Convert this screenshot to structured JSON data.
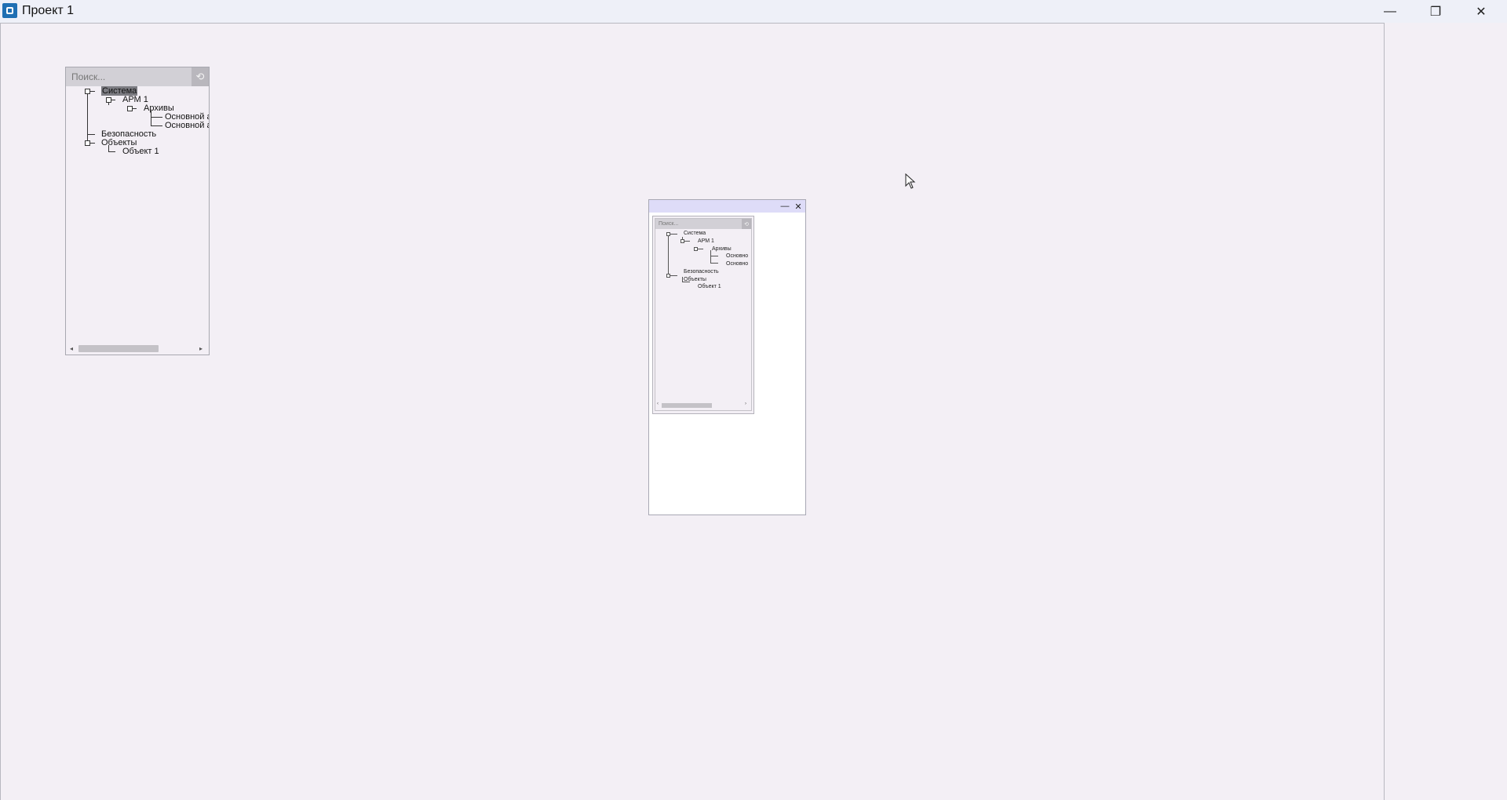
{
  "window": {
    "title": "Проект 1",
    "controls": {
      "minimize": "—",
      "restore": "❐",
      "close": "✕"
    }
  },
  "tree_widget": {
    "search_placeholder": "Поиск...",
    "reset_icon": "⟲",
    "nodes": {
      "system": "Система",
      "arm1": "АРМ 1",
      "archives": "Архивы",
      "main_a1": "Основной а",
      "main_a2": "Основной а",
      "security": "Безопасность",
      "objects": "Объекты",
      "object1": "Объект 1"
    },
    "scroll_left": "◂",
    "scroll_right": "▸"
  },
  "dialog": {
    "minimize": "—",
    "close": "✕",
    "preview": {
      "search_placeholder": "Поиск...",
      "reset_icon": "⟲",
      "nodes": {
        "system": "Система",
        "arm1": "АРМ 1",
        "archives": "Архивы",
        "main1": "Основно",
        "main2": "Основно",
        "security": "Безопасность",
        "objects": "Объекты",
        "object1": "Объект 1"
      },
      "scroll_left": "‹",
      "scroll_right": "›"
    }
  },
  "colors": {
    "canvas": "#f3eff5",
    "titlebar": "#eef0f8",
    "dialog_header": "#dedcf8",
    "selection": "#7c7c82"
  }
}
